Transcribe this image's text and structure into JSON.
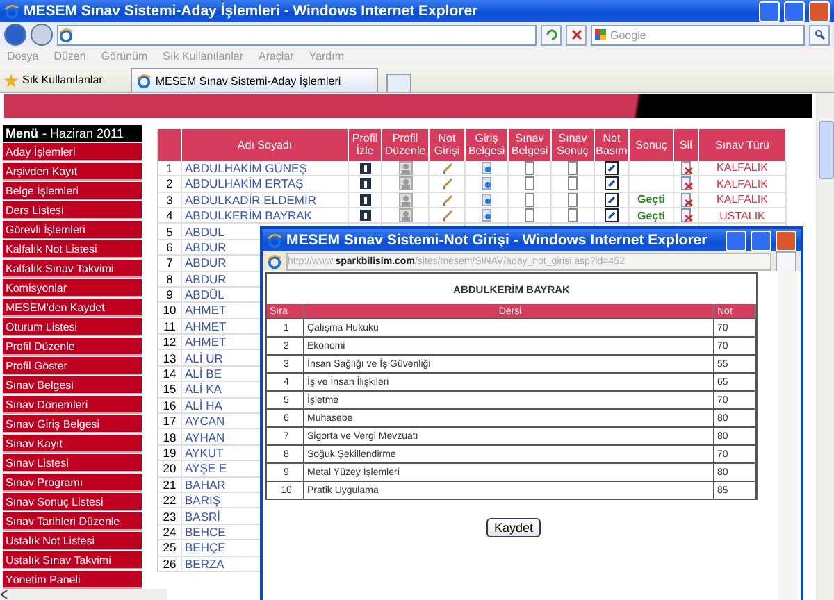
{
  "browser": {
    "title": "MESEM Sınav Sistemi-Aday İşlemleri - Windows Internet Explorer",
    "search_placeholder": "Google",
    "menu": [
      "Dosya",
      "Düzen",
      "Görünüm",
      "Sık Kullanılanlar",
      "Araçlar",
      "Yardım"
    ],
    "favorites": "Sık Kullanılanlar",
    "tabs": [
      {
        "label": "MESEM Sınav Sistemi-Aday İşlemleri",
        "selected": true
      }
    ]
  },
  "sidebar": {
    "title": "Menü",
    "subtitle": "- Haziran 2011",
    "items": [
      "Aday İşlemleri",
      "Arşivden Kayıt",
      "Belge İşlemleri",
      "Ders Listesi",
      "Görevli İşlemleri",
      "Kalfalık Not Listesi",
      "Kalfalık Sınav Takvimi",
      "Komisyonlar",
      "MESEM'den Kaydet",
      "Oturum Listesi",
      "Profil Düzenle",
      "Profil Göster",
      "Sınav Belgesi",
      "Sınav Dönemleri",
      "Sınav Giriş Belgesi",
      "Sınav Kayıt",
      "Sınav Listesi",
      "Sınav Programı",
      "Sınav Sonuç Listesi",
      "Sınav Tarihleri Düzenle",
      "Ustalık Not Listesi",
      "Ustalık Sınav Takvimi",
      "Yönetim Paneli"
    ]
  },
  "table": {
    "columns": [
      {
        "kind": "number"
      },
      {
        "label": "Adı Soyadı",
        "kind": "name"
      },
      {
        "label": "Profil İzle",
        "kind": "view"
      },
      {
        "label": "Profil Düzenle",
        "kind": "edit"
      },
      {
        "label": "Not Girişi",
        "kind": "pencil"
      },
      {
        "label": "Giriş Belgesi",
        "kind": "card"
      },
      {
        "label": "Sınav Belgesi",
        "kind": "doc"
      },
      {
        "label": "Sınav Sonuç",
        "kind": "doc"
      },
      {
        "label": "Not Basım",
        "kind": "print"
      },
      {
        "label": "Sonuç",
        "kind": "result"
      },
      {
        "label": "Sil",
        "kind": "delete"
      },
      {
        "label": "Sınav Türü",
        "kind": "exam_type"
      }
    ],
    "rows": [
      {
        "kind": "full",
        "no": "1",
        "name": "ABDULHAKİM GÜNEŞ",
        "exam_type": "KALFALIK"
      },
      {
        "kind": "full",
        "no": "2",
        "name": "ABDULHAKİM ERTAŞ",
        "exam_type": "KALFALIK"
      },
      {
        "kind": "full",
        "no": "3",
        "name": "ABDULKADİR ELDEMİR",
        "result": "Geçti",
        "exam_type": "KALFALIK"
      },
      {
        "kind": "full",
        "no": "4",
        "name": "ABDULKERİM BAYRAK",
        "result": "Geçti",
        "exam_type": "USTALIK"
      },
      {
        "kind": "partial",
        "no": "5",
        "name": "ABDUL"
      },
      {
        "kind": "partial",
        "no": "6",
        "name": "ABDUR"
      },
      {
        "kind": "partial",
        "no": "7",
        "name": "ABDUR"
      },
      {
        "kind": "partial",
        "no": "8",
        "name": "ABDUR"
      },
      {
        "kind": "partial",
        "no": "9",
        "name": "ABDÜL"
      },
      {
        "kind": "partial",
        "no": "10",
        "name": "AHMET"
      },
      {
        "kind": "partial",
        "no": "11",
        "name": "AHMET"
      },
      {
        "kind": "partial",
        "no": "12",
        "name": "AHMET"
      },
      {
        "kind": "partial",
        "no": "13",
        "name": "ALİ UR"
      },
      {
        "kind": "partial",
        "no": "14",
        "name": "ALİ BE"
      },
      {
        "kind": "partial",
        "no": "15",
        "name": "ALİ KA"
      },
      {
        "kind": "partial",
        "no": "16",
        "name": "ALİ HA"
      },
      {
        "kind": "partial",
        "no": "17",
        "name": "AYCAN"
      },
      {
        "kind": "partial",
        "no": "18",
        "name": "AYHAN"
      },
      {
        "kind": "partial",
        "no": "19",
        "name": "AYKUT"
      },
      {
        "kind": "partial",
        "no": "20",
        "name": "AYŞE E"
      },
      {
        "kind": "partial",
        "no": "21",
        "name": "BAHAR"
      },
      {
        "kind": "partial",
        "no": "22",
        "name": "BARIŞ"
      },
      {
        "kind": "partial",
        "no": "23",
        "name": "BASRİ"
      },
      {
        "kind": "partial",
        "no": "24",
        "name": "BEHCE"
      },
      {
        "kind": "partial",
        "no": "25",
        "name": "BEHÇE"
      },
      {
        "kind": "partial",
        "no": "26",
        "name": "BERZA"
      }
    ]
  },
  "popup": {
    "title": "MESEM Sınav Sistemi-Not Girişi - Windows Internet Explorer",
    "address": "http://www.**sparkbilisim.com**/sites/mesem/SINAV/aday_not_girisi.asp?id=452",
    "student": "ABDULKERİM BAYRAK",
    "columns": [
      "Sıra",
      "Dersi",
      "Not"
    ],
    "rows": [
      [
        "1",
        "Çalışma Hukuku",
        "70"
      ],
      [
        "2",
        "Ekonomi",
        "70"
      ],
      [
        "3",
        "İnsan Sağlığı ve İş Güvenliği",
        "55"
      ],
      [
        "4",
        "İş ve İnsan İlişkileri",
        "65"
      ],
      [
        "5",
        "İşletme",
        "70"
      ],
      [
        "6",
        "Muhasebe",
        "80"
      ],
      [
        "7",
        "Sigorta ve Vergi Mevzuatı",
        "80"
      ],
      [
        "8",
        "Soğuk Şekillendirme",
        "70"
      ],
      [
        "9",
        "Metal Yüzey İşlemleri",
        "80"
      ],
      [
        "10",
        "Pratik Uygulama",
        "85"
      ]
    ],
    "save_button": "Kaydet"
  }
}
